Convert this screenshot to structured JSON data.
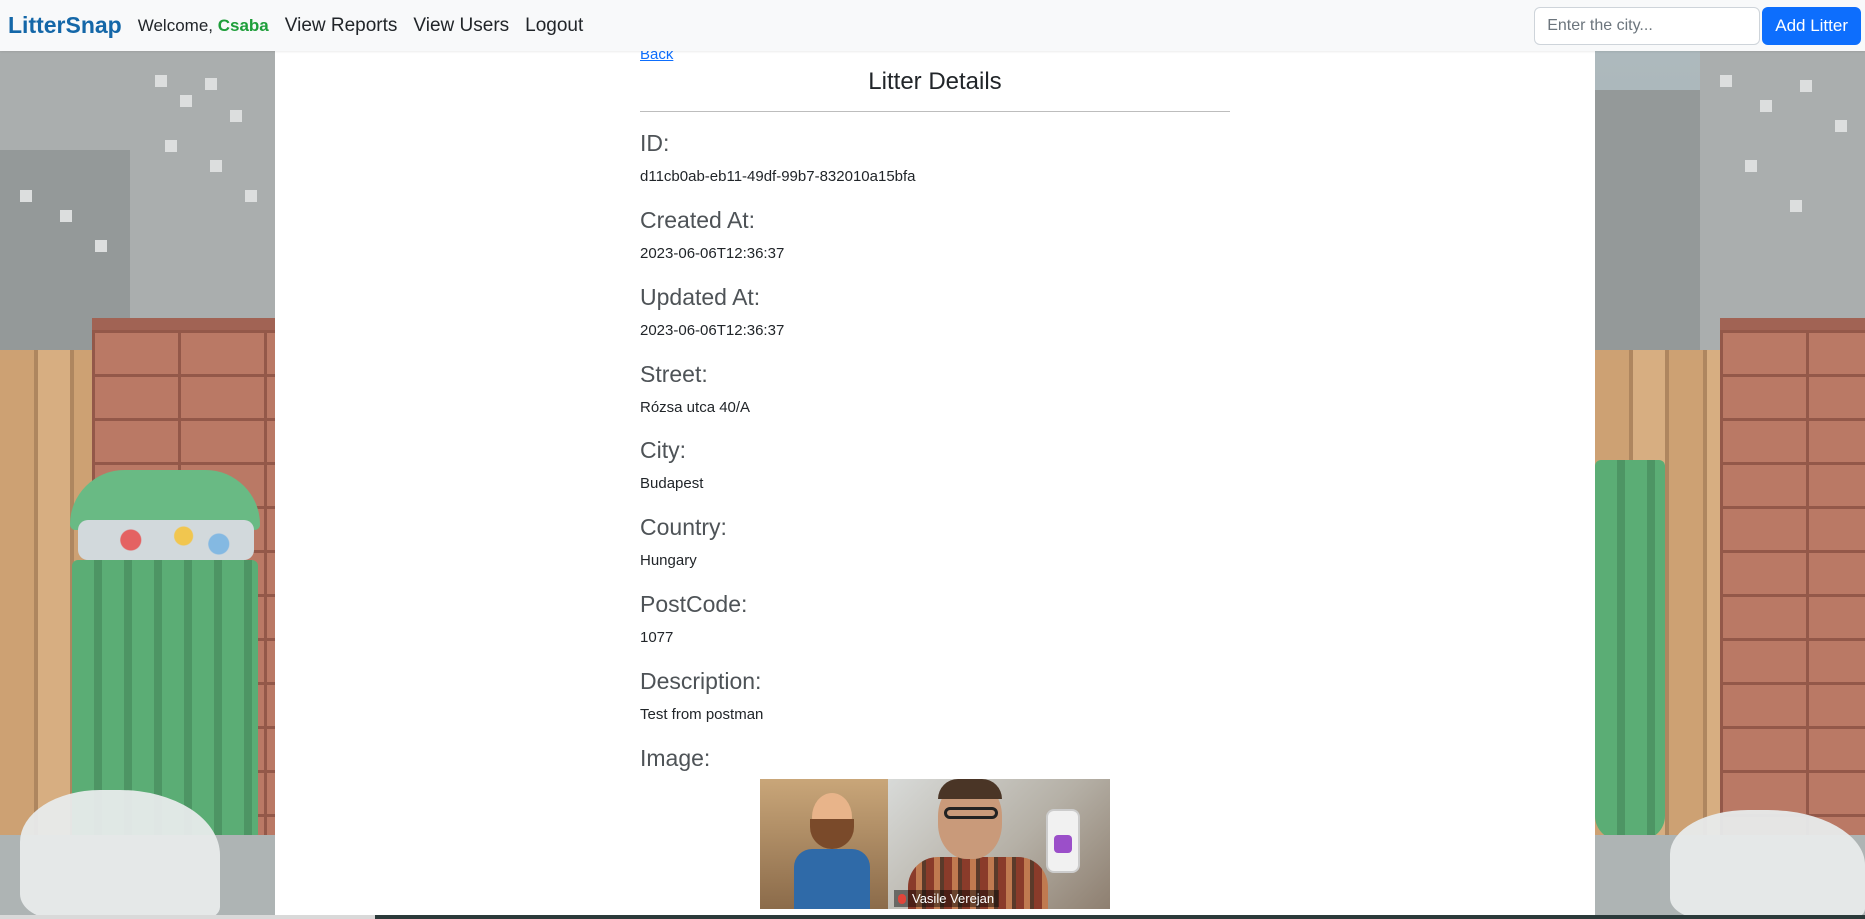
{
  "navbar": {
    "brand": "LitterSnap",
    "welcome_prefix": "Welcome,",
    "username": "Csaba",
    "links": [
      "View Reports",
      "View Users",
      "Logout"
    ],
    "search_placeholder": "Enter the city...",
    "add_button": "Add Litter"
  },
  "page": {
    "back_link": "Back",
    "title": "Litter Details",
    "fields": [
      {
        "label": "ID:",
        "value": "d11cb0ab-eb11-49df-99b7-832010a15bfa"
      },
      {
        "label": "Created At:",
        "value": "2023-06-06T12:36:37"
      },
      {
        "label": "Updated At:",
        "value": "2023-06-06T12:36:37"
      },
      {
        "label": "Street:",
        "value": "Rózsa utca 40/A"
      },
      {
        "label": "City:",
        "value": "Budapest"
      },
      {
        "label": "Country:",
        "value": "Hungary"
      },
      {
        "label": "PostCode:",
        "value": "1077"
      },
      {
        "label": "Description:",
        "value": "Test from postman"
      }
    ],
    "image_label": "Image:",
    "image_caption": "Vasile Verejan"
  },
  "colors": {
    "brand": "#1467a8",
    "username": "#1e9e3a",
    "primary_button": "#0d6efd",
    "link": "#0d6efd"
  }
}
